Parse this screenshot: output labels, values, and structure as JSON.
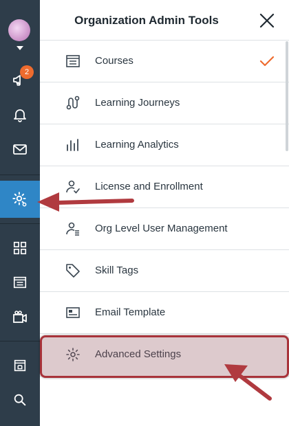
{
  "sidebar": {
    "notification_count": "2",
    "items": [
      {
        "icon": "megaphone-icon"
      },
      {
        "icon": "bell-icon"
      },
      {
        "icon": "mail-icon"
      },
      {
        "icon": "admin-gear-icon"
      },
      {
        "icon": "grid-icon"
      },
      {
        "icon": "catalog-icon"
      },
      {
        "icon": "video-icon"
      },
      {
        "icon": "calendar-icon"
      },
      {
        "icon": "search-icon"
      }
    ]
  },
  "panel": {
    "title": "Organization Admin Tools",
    "items": [
      {
        "label": "Courses",
        "icon": "course-icon",
        "selected": true
      },
      {
        "label": "Learning Journeys",
        "icon": "journey-icon"
      },
      {
        "label": "Learning Analytics",
        "icon": "analytics-icon"
      },
      {
        "label": "License and Enrollment",
        "icon": "license-icon"
      },
      {
        "label": "Org Level User Management",
        "icon": "user-management-icon"
      },
      {
        "label": "Skill Tags",
        "icon": "tag-icon"
      },
      {
        "label": "Email Template",
        "icon": "email-template-icon"
      },
      {
        "label": "Advanced Settings",
        "icon": "settings-gear-icon"
      }
    ]
  },
  "colors": {
    "rail": "#2e3d4a",
    "active": "#2f86c6",
    "badge": "#ee6b2e",
    "check": "#ee6b2e",
    "annotation": "#b03a3f"
  }
}
